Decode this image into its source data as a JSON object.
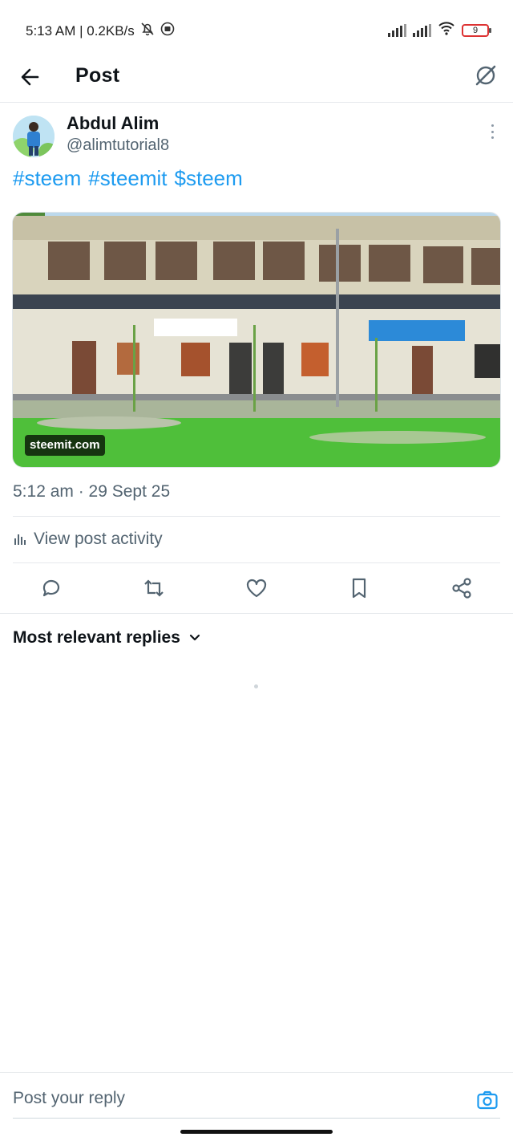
{
  "status_bar": {
    "time_network": "5:13 AM | 0.2KB/s",
    "battery": "9",
    "icons": [
      "mute-icon",
      "whatsapp-icon",
      "signal-icon",
      "wifi-icon",
      "battery-icon"
    ]
  },
  "header": {
    "title": "Post",
    "back_icon": "arrow-left-icon",
    "grok_icon": "grok-icon"
  },
  "post": {
    "author_name": "Abdul Alim",
    "author_handle": "@alimtutorial8",
    "tags": [
      "#steem",
      "#steemit",
      "$steem"
    ],
    "card_label": "steemit.com",
    "timestamp": "5:12 am · 29 Sept 25",
    "activity_label": "View post activity"
  },
  "actions": [
    "reply-icon",
    "repost-icon",
    "like-icon",
    "bookmark-icon",
    "share-icon"
  ],
  "replies": {
    "sort_label": "Most relevant replies"
  },
  "reply_bar": {
    "placeholder": "Post your reply"
  },
  "colors": {
    "accent": "#1d9bf0",
    "secondary_text": "#536471",
    "divider": "#e6e9ec"
  }
}
